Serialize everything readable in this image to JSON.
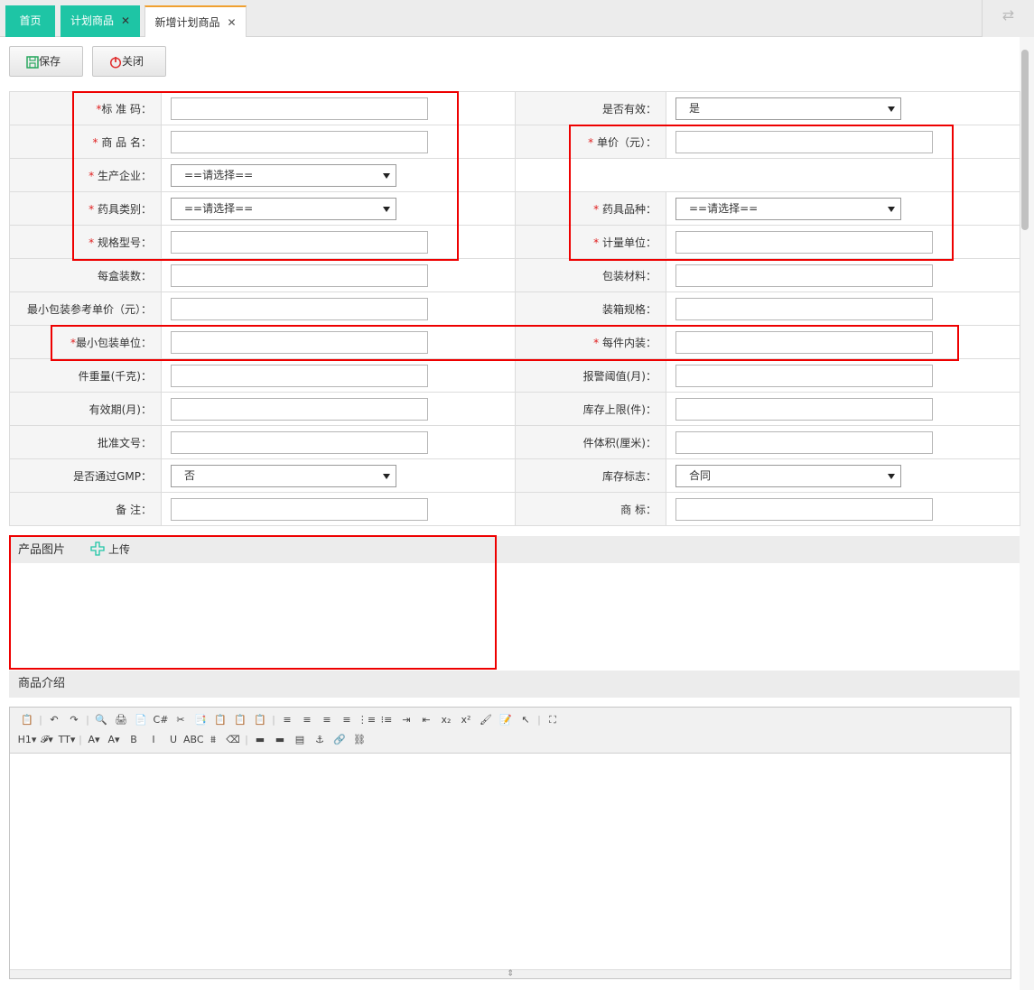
{
  "tabs": [
    {
      "label": "首页"
    },
    {
      "label": "计划商品",
      "close": "✕"
    },
    {
      "label": "新增计划商品",
      "close": "✕"
    }
  ],
  "toolbar": {
    "save_label": "保存",
    "close_label": "关闭"
  },
  "form": {
    "star": "*",
    "standard_code": "标 准 码：",
    "is_valid": "是否有效：",
    "is_valid_value": "是",
    "product_name": "商 品 名：",
    "unit_price": "单价（元）：",
    "manufacturer": "生产企业：",
    "manufacturer_value": "==请选择==",
    "category": "药具类别：",
    "category_value": "==请选择==",
    "variety": "药具品种：",
    "variety_value": "==请选择==",
    "spec": "规格型号：",
    "measure_unit": "计量单位：",
    "per_box": "每盒装数：",
    "packing_material": "包装材料：",
    "min_pack_price": "最小包装参考单价（元）：",
    "box_spec": "装箱规格：",
    "min_pack_unit": "最小包装单位：",
    "inner_pack": "每件内装：",
    "weight": "件重量(千克)：",
    "alarm_threshold": "报警阈值(月)：",
    "validity": "有效期(月)：",
    "stock_limit": "库存上限(件)：",
    "approval_no": "批准文号：",
    "volume": "件体积(厘米)：",
    "gmp": "是否通过GMP：",
    "gmp_value": "否",
    "stock_flag": "库存标志：",
    "stock_flag_value": "合同",
    "remark": "备 注：",
    "trademark": "商 标："
  },
  "sections": {
    "product_image": "产品图片",
    "upload": "上传",
    "product_intro": "商品介绍"
  },
  "editor_toolbar": {
    "row1": [
      "📋",
      "|",
      "↶",
      "↷",
      "|",
      "🔍",
      "🖨",
      "📄",
      "C#",
      "✂",
      "📑",
      "📋",
      "📋",
      "📋",
      "|",
      "≡",
      "≡",
      "≡",
      "≡",
      "⋮≡",
      "⁝≡",
      "⇥",
      "⇤",
      "x₂",
      "x²",
      "🖌",
      "📝",
      "↖",
      "|",
      "⛶"
    ],
    "row2": [
      "H1▾",
      "𝓕▾",
      "TT▾",
      "|",
      "A▾",
      "A▾",
      "B",
      "I",
      "U",
      "ABC",
      "⩩",
      "⌫",
      "|",
      "▬",
      "▬",
      "▤",
      "⚓",
      "🔗",
      "⛓"
    ]
  },
  "colors": {
    "tab_green": "#1ec5a5",
    "required": "#e02020",
    "highlight_box": "#e00000",
    "active_tab_top": "#f0a030"
  },
  "icons": {
    "save": "save-icon",
    "close": "power-icon",
    "upload": "plus-icon",
    "refresh": "refresh-icon"
  }
}
